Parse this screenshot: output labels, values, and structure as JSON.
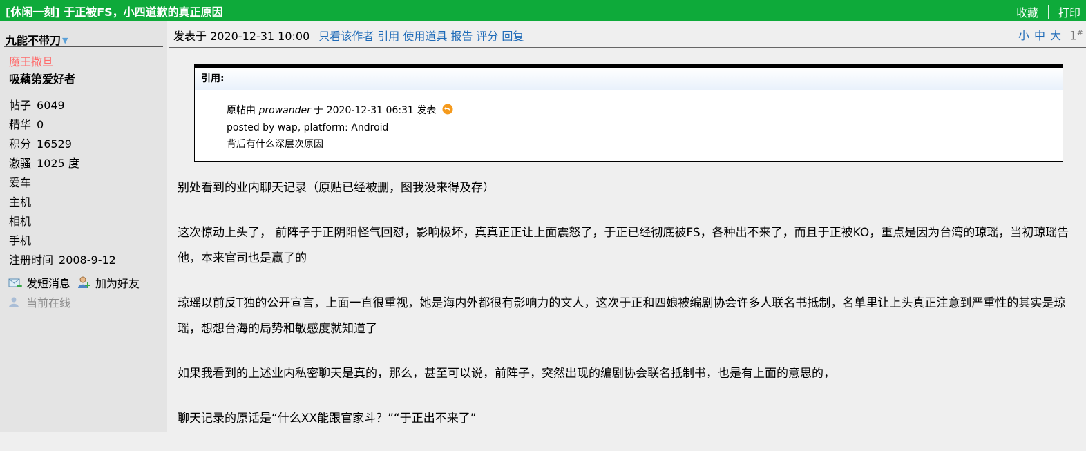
{
  "topbar": {
    "title": "[休闲一刻] 于正被FS，小四道歉的真正原因",
    "favorite_label": "收藏",
    "print_label": "打印",
    "bg_color": "#0eaa3a"
  },
  "sidebar": {
    "author_name": "九能不带刀",
    "rank_title": "魔王撒旦",
    "rank_subtitle": "吸藕第爱好者",
    "stats": [
      {
        "label": "帖子",
        "value": "6049"
      },
      {
        "label": "精华",
        "value": "0"
      },
      {
        "label": "积分",
        "value": "16529"
      },
      {
        "label": "激骚",
        "value": "1025 度"
      },
      {
        "label": "爱车",
        "value": ""
      },
      {
        "label": "主机",
        "value": ""
      },
      {
        "label": "相机",
        "value": ""
      },
      {
        "label": "手机",
        "value": ""
      },
      {
        "label": "注册时间",
        "value": "2008-9-12"
      }
    ],
    "send_message_label": "发短消息",
    "add_friend_label": "加为好友",
    "online_status": "当前在线"
  },
  "post": {
    "posted_at": "发表于 2020-12-31 10:00",
    "actions": [
      "只看该作者",
      "引用",
      "使用道具",
      "报告",
      "评分",
      "回复"
    ],
    "font_sizes": [
      "小",
      "中",
      "大"
    ],
    "floor_number": "1",
    "floor_mark": "#"
  },
  "quote": {
    "header": "引用:",
    "line1_prefix": "原帖由",
    "line1_user": "prowander",
    "line1_suffix": "于 2020-12-31 06:31 发表",
    "line2": "posted by wap, platform: Android",
    "line3": "背后有什么深层次原因"
  },
  "body": {
    "p1": "别处看到的业内聊天记录（原贴已经被删，图我没来得及存）",
    "p2": "这次惊动上头了， 前阵子于正阴阳怪气回怼，影响极坏，真真正正让上面震怒了，于正已经彻底被FS，各种出不来了，而且于正被KO，重点是因为台湾的琼瑶，当初琼瑶告他，本来官司也是赢了的",
    "p3": "琼瑶以前反T独的公开宣言，上面一直很重视，她是海内外都很有影响力的文人，这次于正和四娘被编剧协会许多人联名书抵制，名单里让上头真正注意到严重性的其实是琼瑶，想想台海的局势和敏感度就知道了",
    "p4": "如果我看到的上述业内私密聊天是真的，那么，甚至可以说，前阵子，突然出现的编剧协会联名抵制书，也是有上面的意思的，",
    "p5": "聊天记录的原话是“什么XX能跟官家斗？”“于正出不来了”"
  }
}
